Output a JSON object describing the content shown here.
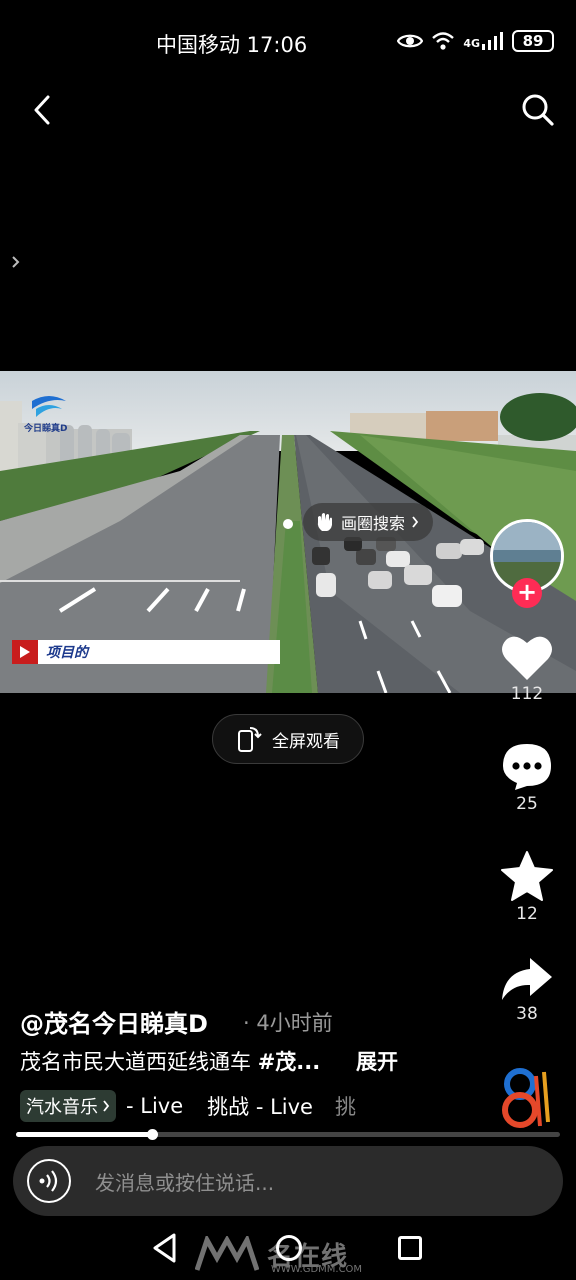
{
  "status_bar": {
    "carrier_time": "中国移动 17:06",
    "network": "4G",
    "battery": "89"
  },
  "video": {
    "logo_text": "今日睇真D",
    "lower_third": "项目的",
    "circle_search_label": "画圈搜索"
  },
  "fullscreen": {
    "label": "全屏观看"
  },
  "actions": {
    "like_count": "112",
    "comment_count": "25",
    "favorite_count": "12",
    "share_count": "38"
  },
  "post": {
    "author": "@茂名今日睇真D",
    "time": "· 4小时前",
    "description": "茂名市民大道西延线通车 ",
    "hashtag": "#茂...",
    "expand": "展开"
  },
  "music": {
    "chip_label": "汽水音乐",
    "items": [
      "- Live",
      "挑战 - Live",
      "挑"
    ]
  },
  "progress": {
    "fraction": 0.25
  },
  "input": {
    "placeholder": "发消息或按住说话..."
  },
  "watermark": {
    "text": "名在线",
    "url": "WWW.GDMM.COM"
  },
  "colors": {
    "accent": "#fe2c55",
    "background": "#000000"
  }
}
